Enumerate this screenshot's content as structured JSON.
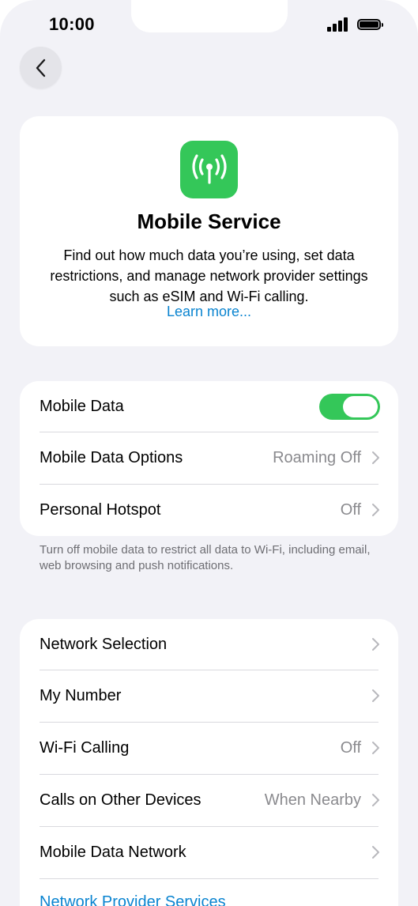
{
  "status_bar": {
    "time": "10:00"
  },
  "hero": {
    "title": "Mobile Service",
    "description": "Find out how much data you’re using, set data restrictions, and manage network provider settings such as eSIM and Wi-Fi calling.",
    "link": "Learn more..."
  },
  "data_section": {
    "mobile_data": {
      "label": "Mobile Data",
      "toggle_on": true
    },
    "mobile_data_options": {
      "label": "Mobile Data Options",
      "value": "Roaming Off"
    },
    "personal_hotspot": {
      "label": "Personal Hotspot",
      "value": "Off"
    },
    "footnote": "Turn off mobile data to restrict all data to Wi-Fi, including email, web browsing and push notifications."
  },
  "network_section": {
    "network_selection": {
      "label": "Network Selection"
    },
    "my_number": {
      "label": "My Number"
    },
    "wifi_calling": {
      "label": "Wi-Fi Calling",
      "value": "Off"
    },
    "calls_other_devices": {
      "label": "Calls on Other Devices",
      "value": "When Nearby"
    },
    "mobile_data_network": {
      "label": "Mobile Data Network"
    },
    "network_provider_services": {
      "label": "Network Provider Services"
    }
  },
  "colors": {
    "accent_green": "#34c759",
    "link_blue": "#0a84d0",
    "background": "#f2f2f7"
  },
  "icons": {
    "app_icon": "antenna-signal-icon",
    "back": "chevron-left-icon",
    "disclosure": "chevron-right-icon"
  }
}
